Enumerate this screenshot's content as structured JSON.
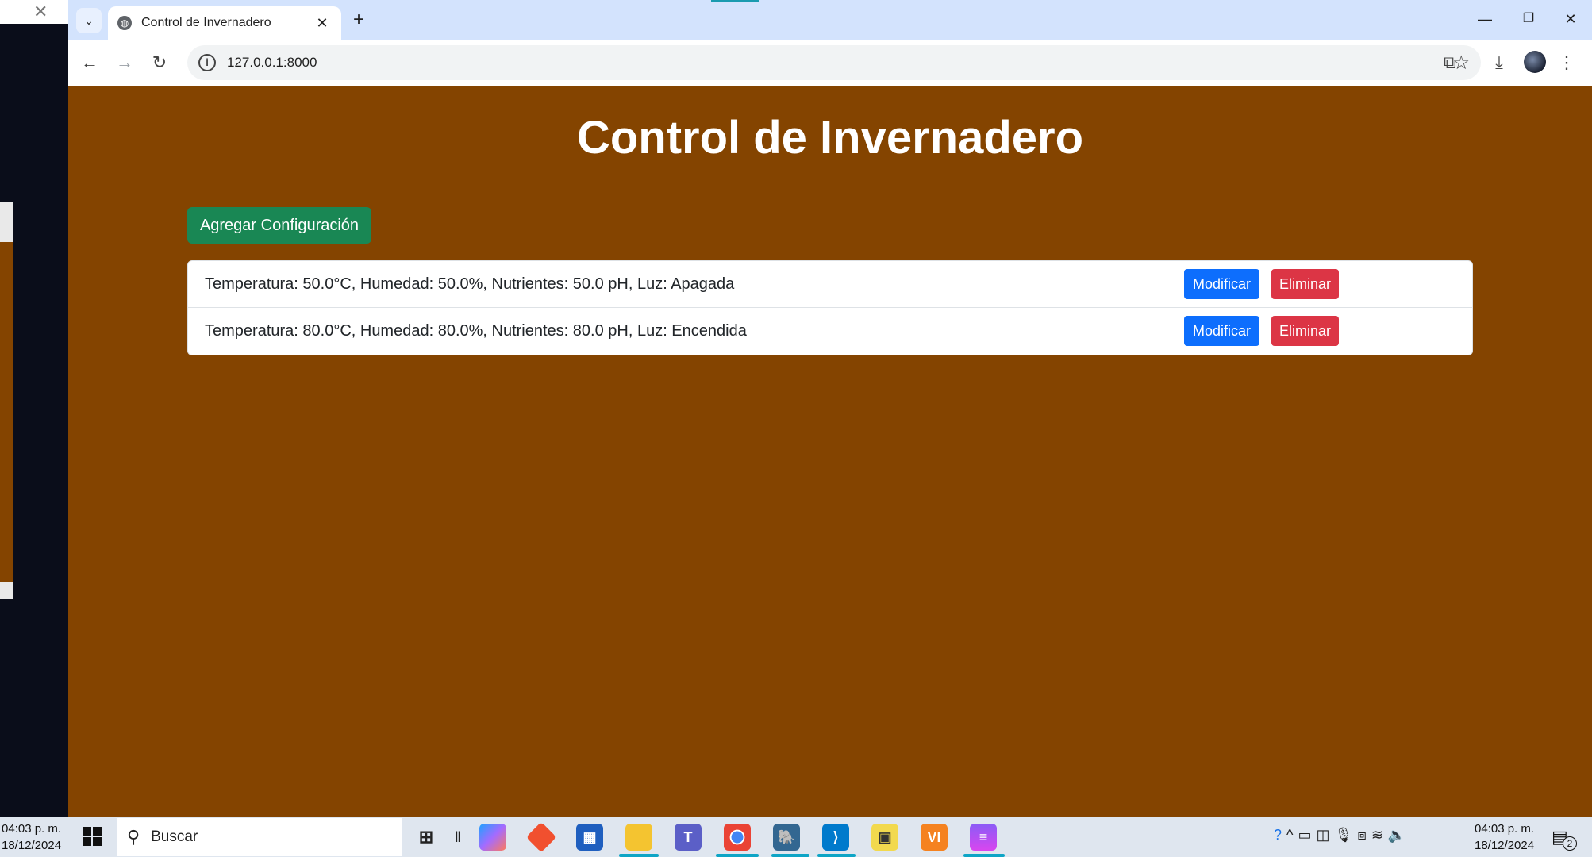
{
  "browser": {
    "tab_title": "Control de Invernadero",
    "url": "127.0.0.1:8000"
  },
  "page": {
    "title": "Control de Invernadero",
    "add_button_label": "Agregar Configuración",
    "configs": [
      {
        "text": "Temperatura: 50.0°C, Humedad: 50.0%, Nutrientes: 50.0 pH, Luz: Apagada",
        "modify_label": "Modificar",
        "delete_label": "Eliminar"
      },
      {
        "text": "Temperatura: 80.0°C, Humedad: 80.0%, Nutrientes: 80.0 pH, Luz: Encendida",
        "modify_label": "Modificar",
        "delete_label": "Eliminar"
      }
    ],
    "colors": {
      "background": "#844400",
      "add_button": "#198754",
      "modify_button": "#0d6efd",
      "delete_button": "#dc3545"
    }
  },
  "taskbar": {
    "left_time": "04:03 p. m.",
    "left_date": "18/12/2024",
    "search_label": "Buscar",
    "right_time": "04:03 p. m.",
    "right_date": "18/12/2024",
    "notification_count": "2",
    "apps": [
      "task-view",
      "copilot",
      "git",
      "microsoft-store",
      "file-explorer",
      "teams",
      "chrome",
      "postgresql",
      "vscode",
      "image-viewer",
      "vi",
      "clapper"
    ]
  }
}
